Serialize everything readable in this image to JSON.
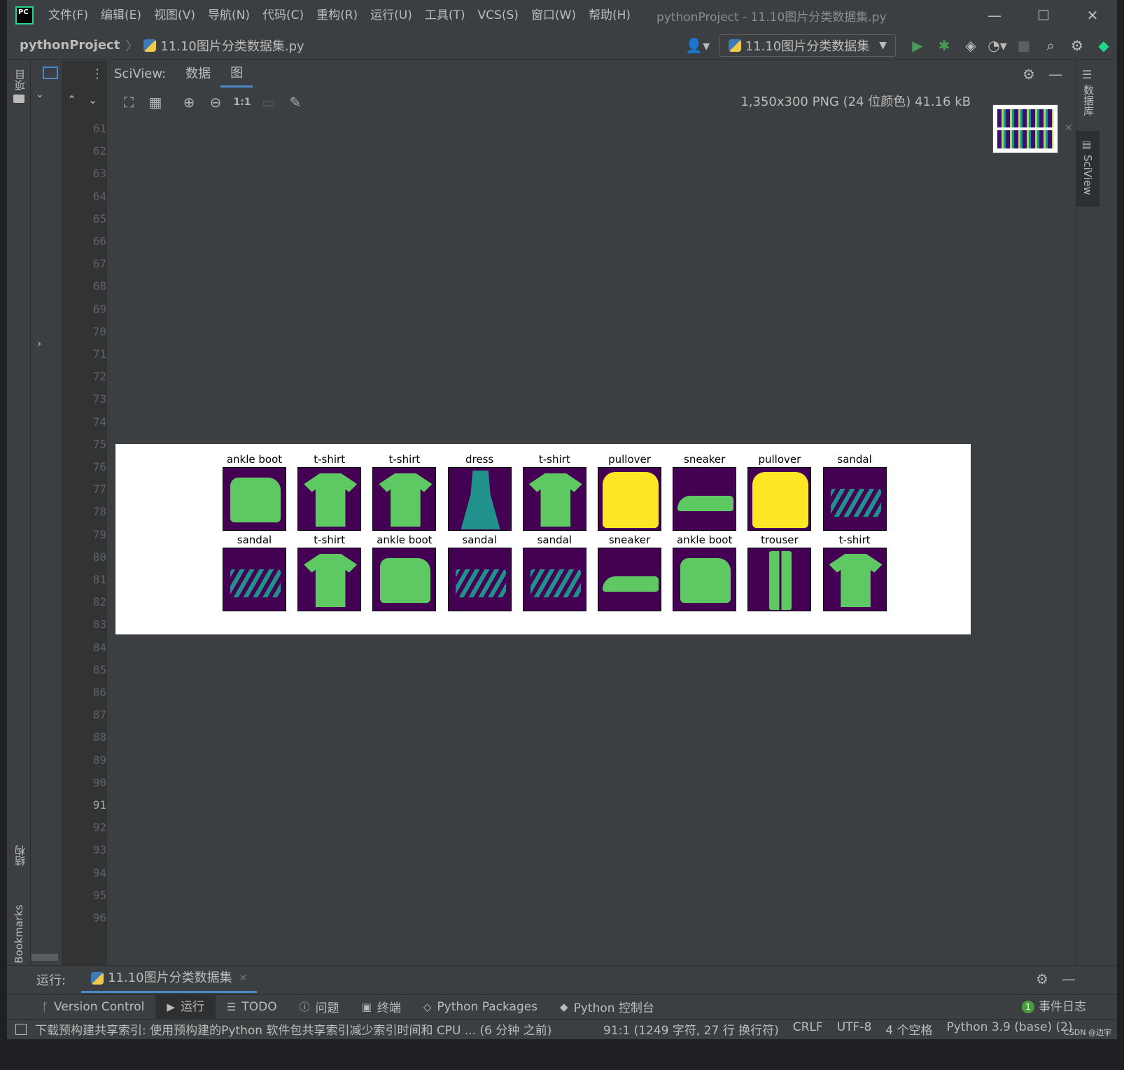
{
  "menu": {
    "items": [
      "文件(F)",
      "编辑(E)",
      "视图(V)",
      "导航(N)",
      "代码(C)",
      "重构(R)",
      "运行(U)",
      "工具(T)",
      "VCS(S)",
      "窗口(W)",
      "帮助(H)"
    ],
    "window_title": "pythonProject - 11.10图片分类数据集.py",
    "logo_text": "PC"
  },
  "navbar": {
    "project": "pythonProject",
    "file": "11.10图片分类数据集.py",
    "run_config": "11.10图片分类数据集"
  },
  "left_stripe": {
    "project_label": "项目",
    "structure_label": "结构",
    "bookmarks_label": "Bookmarks"
  },
  "gutter": {
    "lines": [
      "61",
      "62",
      "63",
      "64",
      "65",
      "66",
      "67",
      "68",
      "69",
      "70",
      "71",
      "72",
      "73",
      "74",
      "75",
      "76",
      "77",
      "78",
      "79",
      "80",
      "81",
      "82",
      "83",
      "84",
      "85",
      "86",
      "87",
      "88",
      "89",
      "90",
      "91",
      "92",
      "93",
      "94",
      "95",
      "96"
    ],
    "current_line": "91"
  },
  "sciview": {
    "title": "SciView:",
    "tabs": [
      "数据",
      "图"
    ],
    "active_tab": "图",
    "image_info": "1,350x300 PNG (24 位颜色) 41.16 kB",
    "zoom_label": "1:1"
  },
  "figure": {
    "colormap": [
      "#440154",
      "#3b528b",
      "#21918c",
      "#5ec962",
      "#fde725"
    ],
    "rows": [
      [
        "ankle boot",
        "t-shirt",
        "t-shirt",
        "dress",
        "t-shirt",
        "pullover",
        "sneaker",
        "pullover",
        "sandal"
      ],
      [
        "sandal",
        "t-shirt",
        "ankle boot",
        "sandal",
        "sandal",
        "sneaker",
        "ankle boot",
        "trouser",
        "t-shirt"
      ]
    ]
  },
  "right_stripe": {
    "database_label": "数据库",
    "sciview_label": "SciView"
  },
  "runbar": {
    "label": "运行:",
    "tab": "11.10图片分类数据集"
  },
  "bottom_tools": {
    "items": [
      "Version Control",
      "运行",
      "TODO",
      "问题",
      "终端",
      "Python Packages",
      "Python 控制台"
    ],
    "event_log": "事件日志",
    "event_count": "1"
  },
  "status": {
    "message": "下载预构建共享索引: 使用预构建的Python 软件包共享索引减少索引时间和 CPU ... (6 分钟 之前)",
    "position": "91:1 (1249 字符, 27 行 换行符)",
    "line_ending": "CRLF",
    "encoding": "UTF-8",
    "indent": "4 个空格",
    "interpreter": "Python 3.9 (base) (2)",
    "watermark": "CSDN @边宇"
  }
}
